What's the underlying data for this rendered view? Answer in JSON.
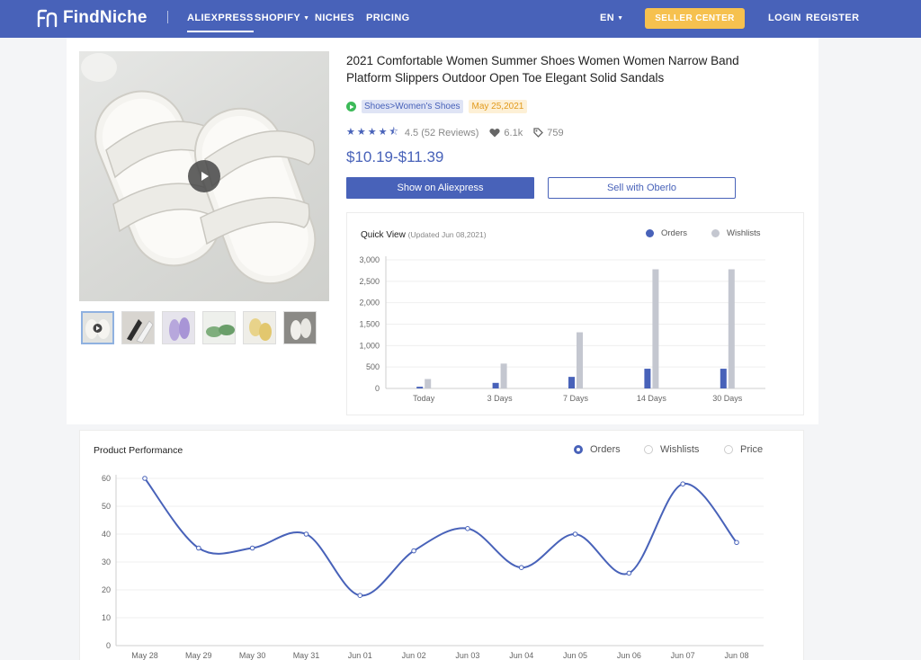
{
  "nav": {
    "logo_text": "FindNiche",
    "items": [
      {
        "label": "ALIEXPRESS",
        "active": true
      },
      {
        "label": "SHOPIFY",
        "caret": true
      },
      {
        "label": "NICHES"
      },
      {
        "label": "PRICING"
      }
    ],
    "language": "EN",
    "seller_center": "SELLER CENTER",
    "login": "LOGIN",
    "register": "REGISTER"
  },
  "product": {
    "title": "2021 Comfortable Women Summer Shoes Women Women Narrow Band Platform Slippers Outdoor Open Toe Elegant Solid Sandals",
    "category": "Shoes>Women's Shoes",
    "date": "May 25,2021",
    "rating": "4.5",
    "reviews": "(52 Reviews)",
    "likes": "6.1k",
    "tags": "759",
    "price": "$10.19-$11.39",
    "show_button": "Show on Aliexpress",
    "sell_button": "Sell with Oberlo"
  },
  "quick_view": {
    "title": "Quick View",
    "updated": "(Updated Jun 08,2021)",
    "legend_orders": "Orders",
    "legend_wishlists": "Wishlists"
  },
  "performance": {
    "title": "Product Performance",
    "radio_orders": "Orders",
    "radio_wishlists": "Wishlists",
    "radio_price": "Price"
  },
  "colors": {
    "brand": "#4862b9",
    "orders": "#4862b9",
    "wishlists": "#c4c7d0",
    "seller": "#f6c14f"
  },
  "chart_data": [
    {
      "type": "bar",
      "categories": [
        "Today",
        "3 Days",
        "7 Days",
        "14 Days",
        "30 Days"
      ],
      "series": [
        {
          "name": "Orders",
          "values": [
            40,
            130,
            270,
            460,
            460
          ]
        },
        {
          "name": "Wishlists",
          "values": [
            220,
            580,
            1310,
            2780,
            2780
          ]
        }
      ],
      "yticks": [
        "0",
        "500",
        "1,000",
        "1,500",
        "2,000",
        "2,500",
        "3,000"
      ],
      "ylim": [
        0,
        3000
      ],
      "grid": "y",
      "legend": "top-right"
    },
    {
      "type": "line",
      "categories": [
        "May 28",
        "May 29",
        "May 30",
        "May 31",
        "Jun 01",
        "Jun 02",
        "Jun 03",
        "Jun 04",
        "Jun 05",
        "Jun 06",
        "Jun 07",
        "Jun 08"
      ],
      "series": [
        {
          "name": "Orders",
          "values": [
            60,
            35,
            35,
            40,
            18,
            34,
            42,
            28,
            40,
            26,
            58,
            37
          ]
        }
      ],
      "yticks": [
        "0",
        "10",
        "20",
        "30",
        "40",
        "50",
        "60"
      ],
      "ylim": [
        0,
        60
      ],
      "grid": "y",
      "smooth": true
    }
  ]
}
